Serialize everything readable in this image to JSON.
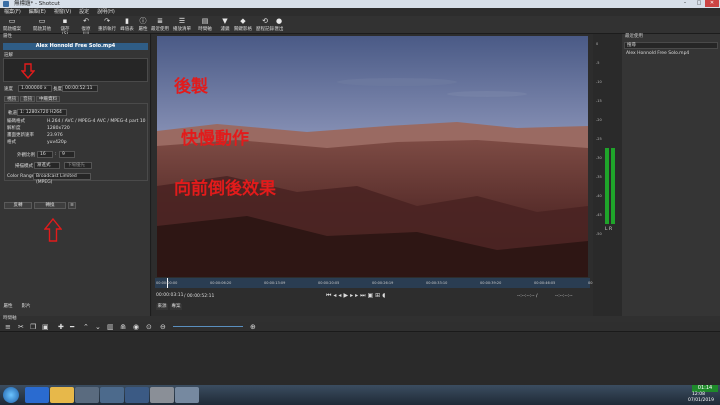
{
  "window": {
    "title": "無標題* - Shotcut"
  },
  "menu": [
    "檔案(F)",
    "編輯(E)",
    "視窗(V)",
    "設定",
    "說明(H)"
  ],
  "toolbar": [
    {
      "label": "開啟檔案",
      "icon": "folder-open-icon"
    },
    {
      "label": "開啟其他",
      "icon": "folder-plus-icon"
    },
    {
      "label": "儲存(S)",
      "icon": "save-icon"
    },
    {
      "label": "復原(U)",
      "icon": "undo-icon"
    },
    {
      "label": "重新執行",
      "icon": "redo-icon"
    },
    {
      "label": "峰值表",
      "icon": "meter-icon"
    },
    {
      "label": "屬性",
      "icon": "info-icon"
    },
    {
      "label": "最近使用",
      "icon": "recent-icon"
    },
    {
      "label": "播放清單",
      "icon": "playlist-icon"
    },
    {
      "label": "時間軸",
      "icon": "timeline-icon"
    },
    {
      "label": "濾鏡",
      "icon": "filter-icon"
    },
    {
      "label": "關鍵影格",
      "icon": "keyframes-icon"
    },
    {
      "label": "歷程記錄",
      "icon": "history-icon"
    },
    {
      "label": "匯出",
      "icon": "export-icon"
    }
  ],
  "properties": {
    "panel_title": "屬性",
    "clip_name": "Alex Honnold Free Solo.mp4",
    "comment_label": "註解",
    "speed_label": "速度",
    "speed_value": "1.000000 x",
    "duration_label": "長度",
    "duration_value": "00:00:52:11",
    "tabs": [
      "視訊",
      "音訊",
      "中繼資料"
    ],
    "track_label": "軌道",
    "track_value": "1: 1280x720 H264",
    "rows": [
      {
        "k": "編碼格式",
        "v": "H.264 / AVC / MPEG-4 AVC / MPEG-4 part 10"
      },
      {
        "k": "解析度",
        "v": "1280x720"
      },
      {
        "k": "畫面更新速率",
        "v": "23.976"
      },
      {
        "k": "格式",
        "v": "yuv420p"
      }
    ],
    "aspect_label": "外觀比例",
    "aspect_w": "16",
    "aspect_h": "9",
    "scan_label": "掃描模式",
    "scan_value": "漸進式",
    "field_value": "下場優先",
    "color_label": "Color Range",
    "color_value": "Broadcast Limited (MPEG)",
    "btn_reverse": "反轉",
    "btn_convert": "轉換",
    "bottom_tabs": [
      "屬性",
      "影片"
    ]
  },
  "overlay": {
    "line1": "後製",
    "line2": "快慢動作",
    "line3": "向前倒後效果"
  },
  "player": {
    "timecodes": [
      "00:00:00:00",
      "00:00:06:20",
      "00:00:13:09",
      "00:00:20:05",
      "00:00:26:19",
      "00:00:33:10",
      "00:00:39:20",
      "00:00:46:05",
      "00:00:52:11"
    ],
    "current": "00:00:03:11",
    "total": "/ 00:00:52:11",
    "in_out_a": "--:--:--:-- /",
    "in_out_b": "--:--:--:--",
    "tabs": [
      "來源",
      "專案"
    ]
  },
  "meter": {
    "labels": [
      "0",
      "-5",
      "-10",
      "-15",
      "-20",
      "-25",
      "-30",
      "-35",
      "-40",
      "-45",
      "-50"
    ],
    "channels": "L R",
    "level_left": 0.72,
    "level_right": 0.72
  },
  "recent": {
    "panel_title": "最近使用",
    "search_placeholder": "搜尋",
    "items": [
      "Alex Honnold Free Solo.mp4"
    ]
  },
  "timeline": {
    "panel_title": "時間軸"
  },
  "taskbar": {
    "time": "12:08",
    "date": "07/01/2019",
    "badge": "01:14"
  }
}
